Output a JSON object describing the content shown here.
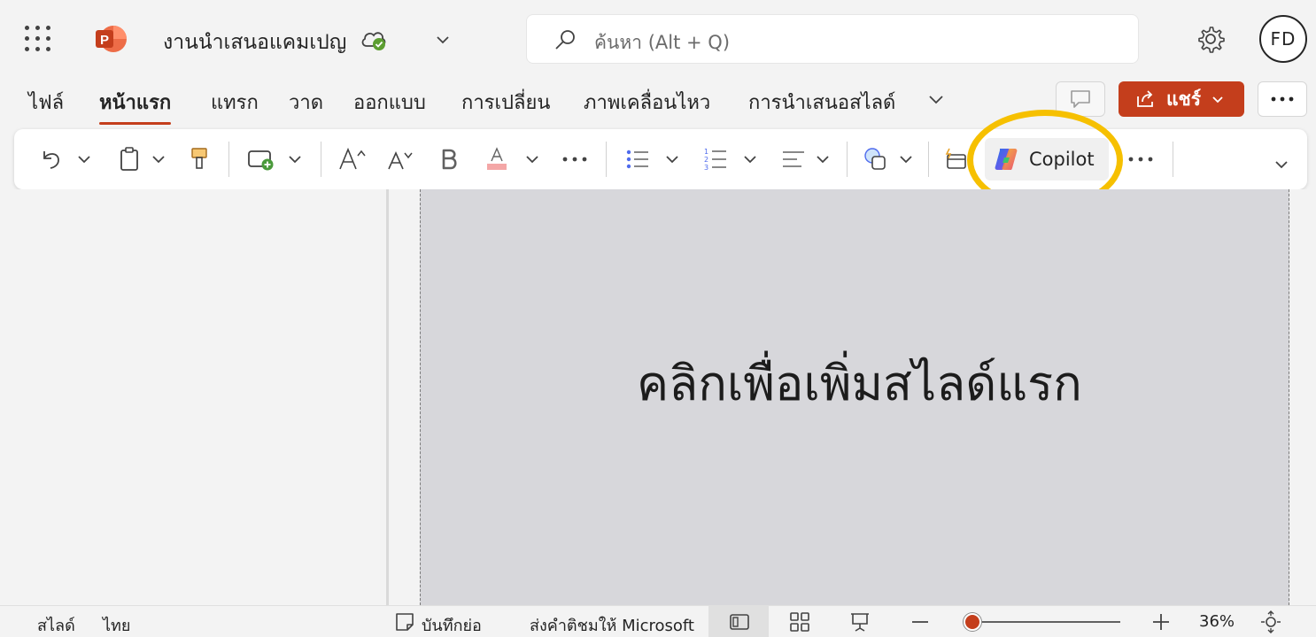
{
  "app": {
    "document_title": "งานนำเสนอแคมเปญ",
    "search": {
      "placeholder": "ค้นหา (Alt + Q)"
    },
    "user_initials": "FD"
  },
  "tabs": [
    "ไฟล์",
    "หน้าแรก",
    "แทรก",
    "วาด",
    "ออกแบบ",
    "การเปลี่ยน",
    "ภาพเคลื่อนไหว",
    "การนำเสนอสไลด์"
  ],
  "active_tab": "หน้าแรก",
  "share": {
    "label": "แชร์"
  },
  "ribbon": {
    "copilot_label": "Copilot"
  },
  "slide": {
    "placeholder": "คลิกเพื่อเพิ่มสไลด์แรก"
  },
  "status": {
    "slide_label": "สไลด์",
    "language": "ไทย",
    "notes_label": "บันทึกย่อ",
    "feedback_label": "ส่งคำติชมให้ Microsoft",
    "zoom_percent": "36%",
    "zoom_level": 36
  },
  "colors": {
    "accent": "#c43e1c",
    "highlight": "#f6c000",
    "slide_bg": "#d7d7db"
  }
}
